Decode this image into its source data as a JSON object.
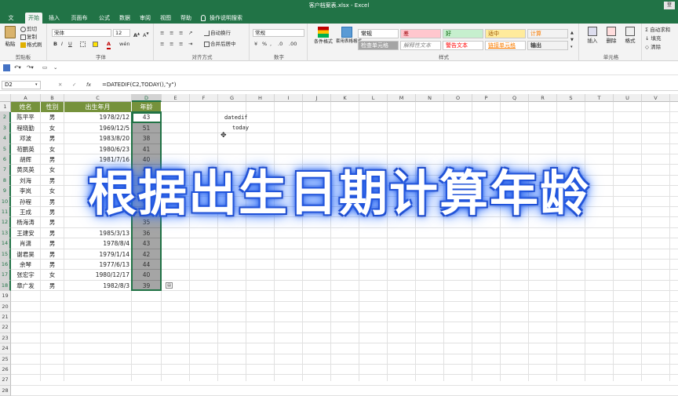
{
  "window": {
    "title": "客户档案表.xlsx - Excel",
    "login_label": "登"
  },
  "tabs": [
    "文件",
    "开始",
    "插入",
    "页面布局",
    "公式",
    "数据",
    "审阅",
    "视图",
    "帮助",
    "操作说明搜索"
  ],
  "ribbon": {
    "clipboard": {
      "label": "剪贴板",
      "cut": "剪切",
      "copy": "复制",
      "format_painter": "格式刷",
      "paste": "粘贴"
    },
    "font": {
      "label": "字体",
      "font_name": "宋体",
      "font_size": "12"
    },
    "alignment": {
      "label": "对齐方式",
      "wrap": "自动换行",
      "merge": "合并后居中"
    },
    "number": {
      "label": "数字",
      "format": "常规"
    },
    "styles": {
      "label": "样式",
      "conditional": "条件格式",
      "table_format": "套用表格格式",
      "cells": [
        {
          "text": "常规",
          "bg": "#ffffff",
          "fg": "#000000"
        },
        {
          "text": "差",
          "bg": "#ffc7ce",
          "fg": "#9c0006"
        },
        {
          "text": "好",
          "bg": "#c6efce",
          "fg": "#006100"
        },
        {
          "text": "适中",
          "bg": "#ffeb9c",
          "fg": "#9c5700"
        },
        {
          "text": "计算",
          "bg": "#f2f2f2",
          "fg": "#fa7d00"
        },
        {
          "text": "检查单元格",
          "bg": "#a5a5a5",
          "fg": "#ffffff"
        },
        {
          "text": "解释性文本",
          "bg": "#ffffff",
          "fg": "#7f7f7f"
        },
        {
          "text": "警告文本",
          "bg": "#ffffff",
          "fg": "#ff0000"
        },
        {
          "text": "链接单元格",
          "bg": "#ffffff",
          "fg": "#fa7d00"
        },
        {
          "text": "输出",
          "bg": "#f2f2f2",
          "fg": "#3f3f3f"
        }
      ]
    },
    "cells": {
      "label": "单元格",
      "insert": "插入",
      "delete": "删除",
      "format": "格式"
    },
    "editing": {
      "autosum": "自动求和",
      "fill": "填充",
      "clear": "清除"
    }
  },
  "formula_bar": {
    "name_box": "D2",
    "formula": "=DATEDIF(C2,TODAY(),\"y\")",
    "fx": "fx"
  },
  "columns": [
    "A",
    "B",
    "C",
    "D",
    "E",
    "F",
    "G",
    "H",
    "I",
    "J",
    "K",
    "L",
    "M",
    "N",
    "O",
    "P",
    "Q",
    "R",
    "S",
    "T",
    "U",
    "V",
    "W"
  ],
  "rows": [
    "1",
    "2",
    "3",
    "4",
    "5",
    "6",
    "7",
    "8",
    "9",
    "10",
    "11",
    "12",
    "13",
    "14",
    "15",
    "16",
    "17",
    "18",
    "19",
    "20",
    "21",
    "22",
    "23",
    "24",
    "25",
    "26",
    "27",
    "28"
  ],
  "table": {
    "headers": [
      "姓名",
      "性别",
      "出生年月",
      "年龄"
    ],
    "records": [
      [
        "陈平平",
        "男",
        "1978/2/12",
        "43"
      ],
      [
        "程晓勤",
        "女",
        "1969/12/5",
        "51"
      ],
      [
        "邓波",
        "男",
        "1983/8/20",
        "38"
      ],
      [
        "苟鹏英",
        "女",
        "1980/6/23",
        "41"
      ],
      [
        "胡辉",
        "男",
        "1981/7/16",
        "40"
      ],
      [
        "黄凤英",
        "女",
        "",
        "40"
      ],
      [
        "刘海",
        "男",
        "",
        "38"
      ],
      [
        "李岚",
        "女",
        "1",
        "32"
      ],
      [
        "孙程",
        "男",
        "1",
        "43"
      ],
      [
        "王成",
        "男",
        "",
        "36"
      ],
      [
        "杨海涛",
        "男",
        "",
        "35"
      ],
      [
        "王建安",
        "男",
        "1985/3/13",
        "36"
      ],
      [
        "肖潇",
        "男",
        "1978/8/4",
        "43"
      ],
      [
        "谢君昊",
        "男",
        "1979/1/14",
        "42"
      ],
      [
        "余琴",
        "男",
        "1977/6/13",
        "44"
      ],
      [
        "张宏宇",
        "女",
        "1980/12/17",
        "40"
      ],
      [
        "章广发",
        "男",
        "1982/8/3",
        "39"
      ]
    ]
  },
  "notes": {
    "g2": "datedif",
    "g3": "today"
  },
  "overlay_title": "根据出生日期计算年龄"
}
